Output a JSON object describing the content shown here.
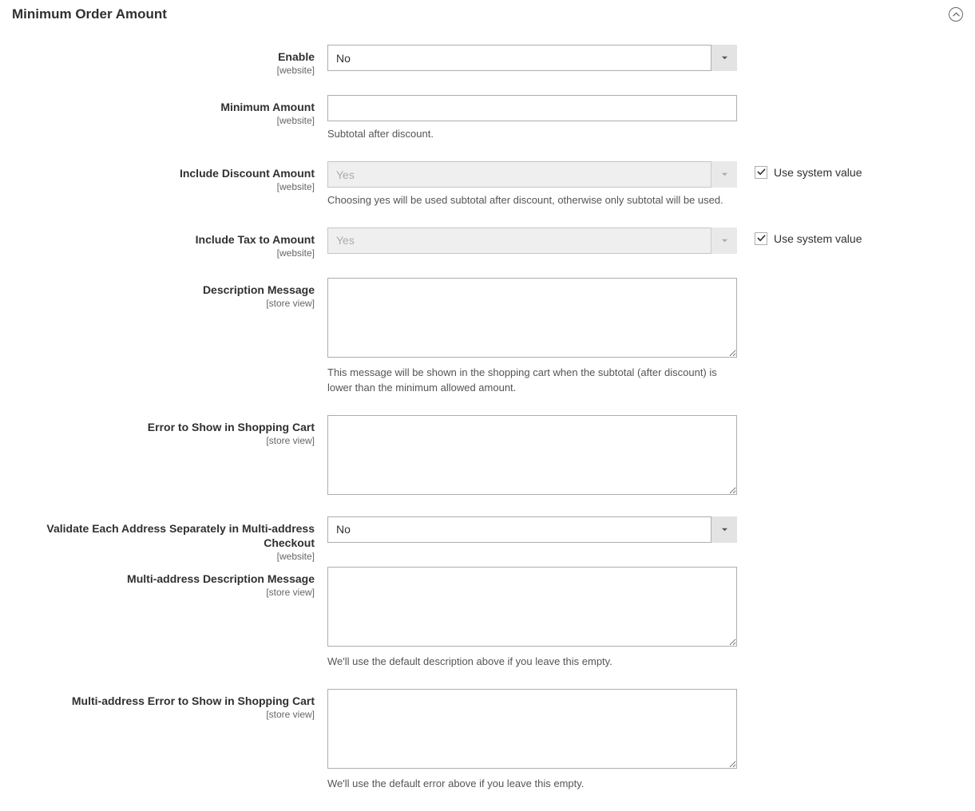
{
  "section": {
    "title": "Minimum Order Amount"
  },
  "scopes": {
    "website": "[website]",
    "store_view": "[store view]"
  },
  "use_system_value": "Use system value",
  "fields": {
    "enable": {
      "label": "Enable",
      "value": "No"
    },
    "minimum_amount": {
      "label": "Minimum Amount",
      "value": "",
      "help": "Subtotal after discount."
    },
    "include_discount": {
      "label": "Include Discount Amount",
      "value": "Yes",
      "help": "Choosing yes will be used subtotal after discount, otherwise only subtotal will be used.",
      "use_system": true
    },
    "include_tax": {
      "label": "Include Tax to Amount",
      "value": "Yes",
      "use_system": true
    },
    "description_message": {
      "label": "Description Message",
      "value": "",
      "help": "This message will be shown in the shopping cart when the subtotal (after discount) is lower than the minimum allowed amount."
    },
    "error_cart": {
      "label": "Error to Show in Shopping Cart",
      "value": ""
    },
    "validate_multi": {
      "label": "Validate Each Address Separately in Multi-address Checkout",
      "value": "No"
    },
    "multi_desc": {
      "label": "Multi-address Description Message",
      "value": "",
      "help": "We'll use the default description above if you leave this empty."
    },
    "multi_error": {
      "label": "Multi-address Error to Show in Shopping Cart",
      "value": "",
      "help": "We'll use the default error above if you leave this empty."
    }
  }
}
